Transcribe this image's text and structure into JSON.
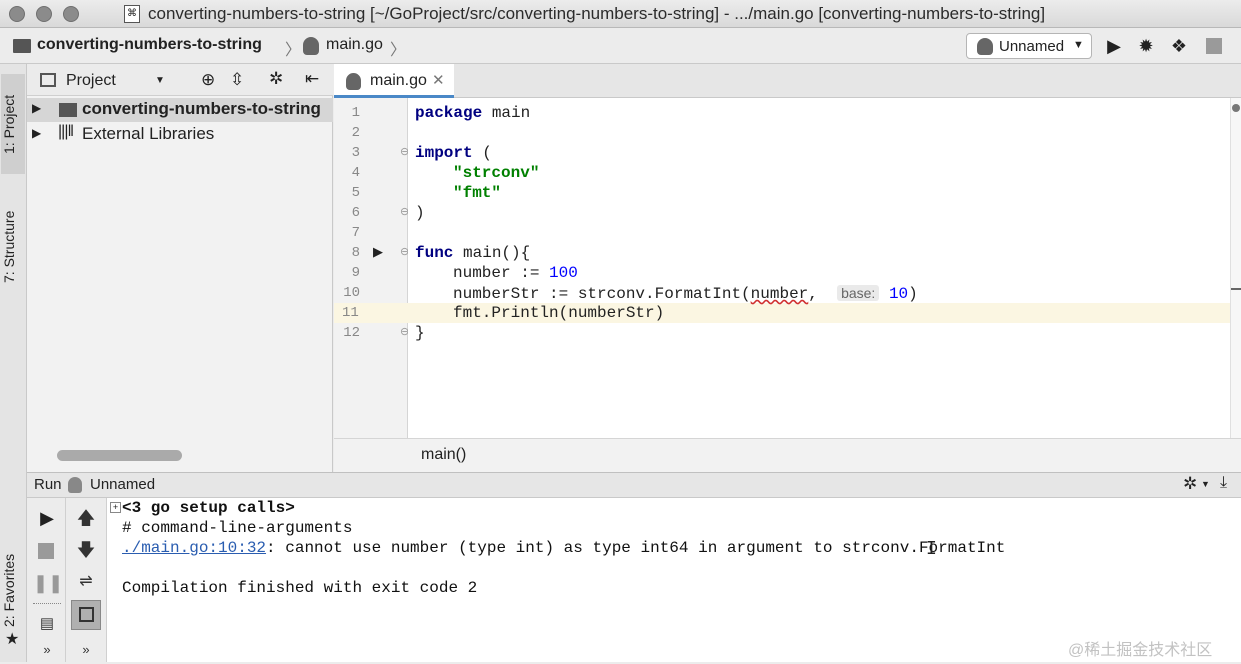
{
  "window": {
    "title": "converting-numbers-to-string [~/GoProject/src/converting-numbers-to-string] - .../main.go [converting-numbers-to-string]"
  },
  "navbar": {
    "project_crumb": "converting-numbers-to-string",
    "file_crumb": "main.go",
    "run_config": "Unnamed"
  },
  "left_strip": {
    "project_tab": "1: Project",
    "structure_tab": "7: Structure",
    "favorites_tab": "2: Favorites"
  },
  "project_panel": {
    "dropdown": "Project",
    "tree": [
      {
        "label": "converting-numbers-to-string"
      },
      {
        "label": "External Libraries"
      }
    ]
  },
  "editor": {
    "tab": "main.go",
    "line_numbers": [
      "1",
      "2",
      "3",
      "4",
      "5",
      "6",
      "7",
      "8",
      "9",
      "10",
      "11",
      "12"
    ],
    "lines": {
      "l1_kw": "package",
      "l1_rest": " main",
      "l3_kw": "import",
      "l3_rest": " (",
      "l4": "\"strconv\"",
      "l5": "\"fmt\"",
      "l6": ")",
      "l8_kw": "func",
      "l8_rest": " main(){",
      "l9_a": "number := ",
      "l9_num": "100",
      "l10_a": "numberStr := strconv.FormatInt(",
      "l10_err": "number",
      "l10_b": ",  ",
      "l10_hint": "base:",
      "l10_num": "10",
      "l10_c": ")",
      "l11": "fmt.Println(numberStr)",
      "l12": "}"
    },
    "breadcrumb": "main()"
  },
  "run_panel": {
    "label": "Run",
    "config": "Unnamed",
    "console": {
      "setup_calls": "<3 go setup calls>",
      "line2": "# command-line-arguments",
      "error_link": "./main.go:10:32",
      "error_msg": ": cannot use number (type int) as type int64 in argument to strconv.FormatInt",
      "finish": "Compilation finished with exit code 2"
    }
  },
  "watermark": "@稀土掘金技术社区"
}
